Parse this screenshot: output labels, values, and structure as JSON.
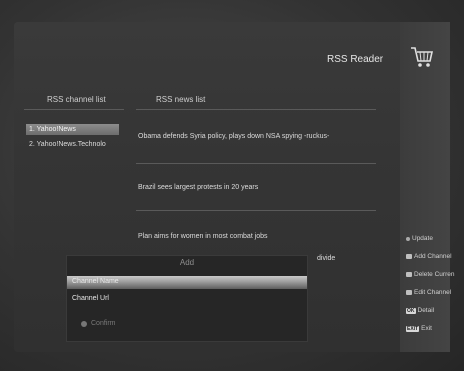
{
  "header": {
    "title": "RSS Reader"
  },
  "columns": {
    "channel_list": "RSS channel list",
    "news_list": "RSS news list"
  },
  "channels": [
    {
      "label": "1. Yahoo!News"
    },
    {
      "label": "2. Yahoo!News.Technolo"
    }
  ],
  "news": [
    {
      "text": "Obama defends Syria policy, plays down NSA spying -ruckus-"
    },
    {
      "text": "Brazil sees largest protests in 20 years"
    },
    {
      "text": "Plan aims for women in most combat jobs"
    },
    {
      "text": "divide"
    }
  ],
  "menu": {
    "update": "Update",
    "add_channel": "Add Channel",
    "delete_current": "Delete Curren",
    "edit_channel": "Edit Channel",
    "ok_key": "OK",
    "detail": "Detail",
    "exit_key": "EXIT",
    "exit": "Exit"
  },
  "dialog": {
    "title": "Add",
    "channel_name_label": "Channel Name",
    "channel_url_label": "Channel Url",
    "confirm": "Confirm"
  }
}
